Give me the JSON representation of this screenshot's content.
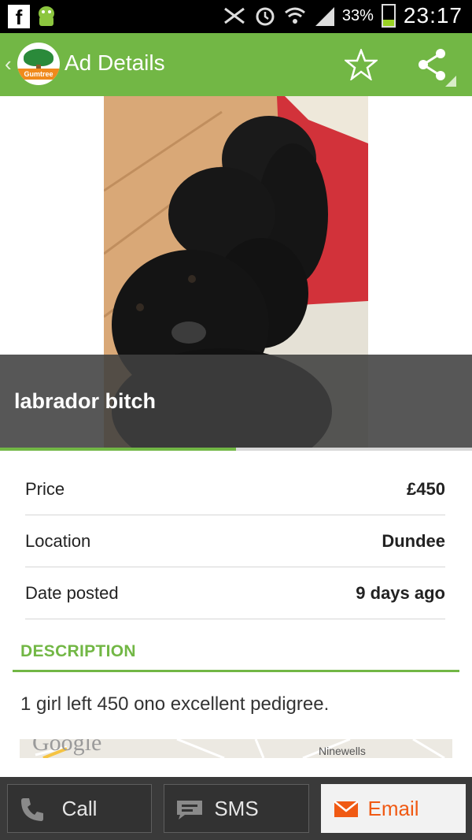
{
  "status_bar": {
    "battery_percent": "33%",
    "time": "23:17",
    "icons": [
      "facebook-icon",
      "android-icon",
      "nfc-icon",
      "alarm-icon",
      "wifi-icon",
      "signal-icon",
      "battery-icon"
    ]
  },
  "action_bar": {
    "title": "Ad Details",
    "logo_text": "Gumtree",
    "accent": "#72b745"
  },
  "ad": {
    "title": "labrador bitch",
    "image_progress": 0.5
  },
  "details": [
    {
      "label": "Price",
      "value": "£450"
    },
    {
      "label": "Location",
      "value": "Dundee"
    },
    {
      "label": "Date posted",
      "value": "9 days ago"
    }
  ],
  "description": {
    "heading": "DESCRIPTION",
    "text": "1 girl left 450 ono excellent pedigree."
  },
  "map": {
    "logo_text": "Google",
    "place_label": "Ninewells"
  },
  "bottom_bar": {
    "call_label": "Call",
    "sms_label": "SMS",
    "email_label": "Email",
    "email_color": "#f05a14"
  }
}
